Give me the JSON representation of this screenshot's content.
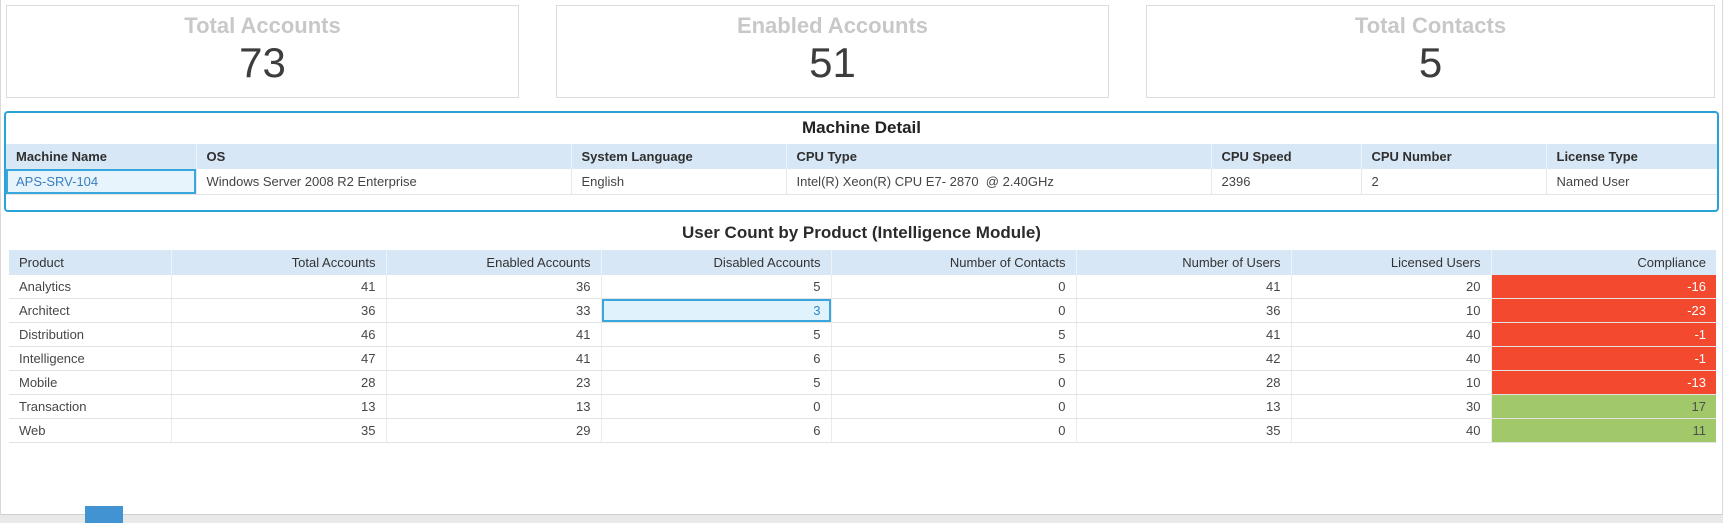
{
  "stats": [
    {
      "label": "Total Accounts",
      "value": "73"
    },
    {
      "label": "Enabled Accounts",
      "value": "51"
    },
    {
      "label": "Total Contacts",
      "value": "5"
    }
  ],
  "machine_detail": {
    "title": "Machine Detail",
    "columns": [
      "Machine Name",
      "OS",
      "System Language",
      "CPU Type",
      "CPU Speed",
      "CPU Number",
      "License Type"
    ],
    "row": {
      "machine_name": "APS-SRV-104",
      "os": "Windows Server 2008 R2 Enterprise",
      "system_language": "English",
      "cpu_type": "Intel(R) Xeon(R) CPU E7- 2870  @ 2.40GHz",
      "cpu_speed": "2396",
      "cpu_number": "2",
      "license_type": "Named User"
    }
  },
  "user_count": {
    "title": "User Count by Product (Intelligence Module)",
    "columns": [
      "Product",
      "Total Accounts",
      "Enabled Accounts",
      "Disabled Accounts",
      "Number of Contacts",
      "Number of Users",
      "Licensed Users",
      "Compliance"
    ],
    "rows": [
      {
        "product": "Analytics",
        "total_accounts": "41",
        "enabled_accounts": "36",
        "disabled_accounts": "5",
        "number_of_contacts": "0",
        "number_of_users": "41",
        "licensed_users": "20",
        "compliance": "-16"
      },
      {
        "product": "Architect",
        "total_accounts": "36",
        "enabled_accounts": "33",
        "disabled_accounts": "3",
        "number_of_contacts": "0",
        "number_of_users": "36",
        "licensed_users": "10",
        "compliance": "-23"
      },
      {
        "product": "Distribution",
        "total_accounts": "46",
        "enabled_accounts": "41",
        "disabled_accounts": "5",
        "number_of_contacts": "5",
        "number_of_users": "41",
        "licensed_users": "40",
        "compliance": "-1"
      },
      {
        "product": "Intelligence",
        "total_accounts": "47",
        "enabled_accounts": "41",
        "disabled_accounts": "6",
        "number_of_contacts": "5",
        "number_of_users": "42",
        "licensed_users": "40",
        "compliance": "-1"
      },
      {
        "product": "Mobile",
        "total_accounts": "28",
        "enabled_accounts": "23",
        "disabled_accounts": "5",
        "number_of_contacts": "0",
        "number_of_users": "28",
        "licensed_users": "10",
        "compliance": "-13"
      },
      {
        "product": "Transaction",
        "total_accounts": "13",
        "enabled_accounts": "13",
        "disabled_accounts": "0",
        "number_of_contacts": "0",
        "number_of_users": "13",
        "licensed_users": "30",
        "compliance": "17"
      },
      {
        "product": "Web",
        "total_accounts": "35",
        "enabled_accounts": "29",
        "disabled_accounts": "6",
        "number_of_contacts": "0",
        "number_of_users": "35",
        "licensed_users": "40",
        "compliance": "11"
      }
    ]
  },
  "colors": {
    "compliance_negative_bg": "#f2492f",
    "compliance_positive_bg": "#a1c969",
    "panel_border_blue": "#29a2d8",
    "table_header_bg": "#d8e7f6",
    "selected_cell_border": "#39a7dd",
    "machine_link_blue": "#3a7ebf"
  }
}
